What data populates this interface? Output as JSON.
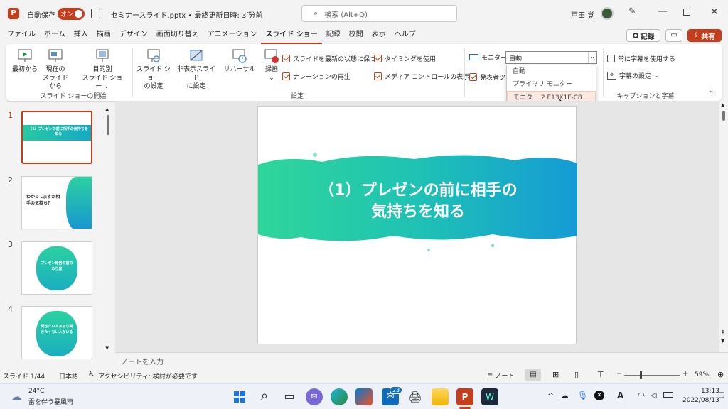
{
  "titlebar": {
    "autosave_label": "自動保存",
    "autosave_state": "オン",
    "file_title": "セミナースライド.pptx • 最終更新日時: 3 分前",
    "search_placeholder": "検索 (Alt+Q)",
    "user_name": "戸田 覚"
  },
  "tabs": [
    "ファイル",
    "ホーム",
    "挿入",
    "描画",
    "デザイン",
    "画面切り替え",
    "アニメーション",
    "スライド ショー",
    "記録",
    "校閲",
    "表示",
    "ヘルプ"
  ],
  "active_tab": "スライド ショー",
  "record_button": "記録",
  "share_button": "共有",
  "ribbon": {
    "start_group": {
      "name": "スライド ショーの開始",
      "from_beginning": "最初から",
      "from_current_1": "現在の",
      "from_current_2": "スライドから",
      "custom_1": "目的別",
      "custom_2": "スライド ショー"
    },
    "settings_group": {
      "name": "設定",
      "setup_1": "スライド ショー",
      "setup_2": "の設定",
      "hide_1": "非表示スライド",
      "hide_2": "に設定",
      "rehearse": "リハーサル",
      "record": "録画",
      "check_keep_updated": "スライドを最新の状態に保つ",
      "check_narration": "ナレーションの再生",
      "check_timing": "タイミングを使用",
      "check_media": "メディア コントロールの表示"
    },
    "monitor_group": {
      "monitor_label": "モニター:",
      "monitor_value": "自動",
      "presenter_view": "発表者ツ"
    },
    "captions_group": {
      "name": "キャプションと字幕",
      "always_subtitles": "常に字幕を使用する",
      "subtitle_settings": "字幕の設定"
    }
  },
  "dropdown": [
    "自動",
    "プライマリ モニター",
    "モニター 2 E13K1F-C8"
  ],
  "slides": [
    {
      "num": "1",
      "text": "（1）プレゼンの前に相手の気持ちを知る"
    },
    {
      "num": "2",
      "text": "わかってますか相手の気持ち？"
    },
    {
      "num": "3",
      "text": "プレゼン報告の前のめり度"
    },
    {
      "num": "4",
      "text": "聞きたい人あまり聞きたくない人がいる"
    }
  ],
  "main_slide": {
    "line1": "（1）プレゼンの前に相手の",
    "line2": "気持ちを知る"
  },
  "notes_placeholder": "ノートを入力",
  "status": {
    "slide_count": "スライド 1/44",
    "language": "日本語",
    "accessibility": "アクセシビリティ: 検討が必要です",
    "notes": "ノート",
    "zoom": "59%"
  },
  "taskbar": {
    "weather_temp": "24°C",
    "weather_desc": "雷を伴う暴風雨",
    "mail_badge": "23",
    "ime": "A",
    "time": "13:13",
    "date": "2022/08/13"
  },
  "colors": {
    "accent": "#c43e1c",
    "teal": "#1fb9a8"
  }
}
